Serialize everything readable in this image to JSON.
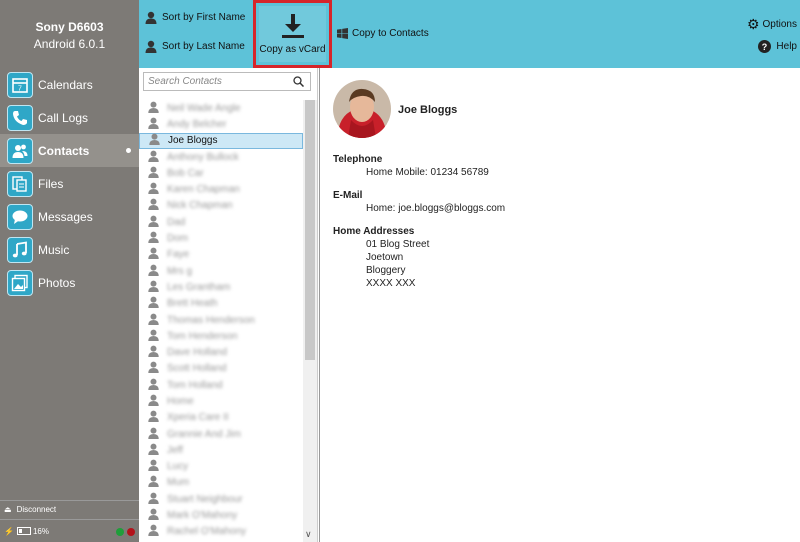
{
  "device": {
    "name": "Sony D6603",
    "os": "Android 6.0.1"
  },
  "sidebar": {
    "items": [
      {
        "label": "Calendars",
        "icon": "calendar-icon"
      },
      {
        "label": "Call Logs",
        "icon": "phone-icon"
      },
      {
        "label": "Contacts",
        "icon": "contacts-icon",
        "active": true
      },
      {
        "label": "Files",
        "icon": "files-icon"
      },
      {
        "label": "Messages",
        "icon": "message-icon"
      },
      {
        "label": "Music",
        "icon": "music-icon"
      },
      {
        "label": "Photos",
        "icon": "photos-icon"
      }
    ],
    "disconnect_label": "Disconnect",
    "battery_label": "16%"
  },
  "toolbar": {
    "sort_first": "Sort by First Name",
    "sort_last": "Sort by Last Name",
    "copy_vcard": "Copy as vCard",
    "copy_contacts": "Copy to Contacts",
    "options": "Options",
    "help": "Help"
  },
  "search": {
    "placeholder": "Search Contacts"
  },
  "contacts": [
    "Neil Wade Angle",
    "Andy Belcher",
    "Joe Bloggs",
    "Anthony Bullock",
    "Bob Car",
    "Karen Chapman",
    "Nick Chapman",
    "Dad",
    "Dom",
    "Faye",
    "Mrs g",
    "Les Grantham",
    "Brett Heath",
    "Thomas Henderson",
    "Tom Henderson",
    "Dave Holland",
    "Scott Holland",
    "Tom Holland",
    "Home",
    "Xperia Care II",
    "Grannie And Jim",
    "Jeff",
    "Lucy",
    "Mum",
    "Stuart Neighbour",
    "Mark O'Mahony",
    "Rachel O'Mahony"
  ],
  "selected_index": 2,
  "detail": {
    "name": "Joe Bloggs",
    "telephone_heading": "Telephone",
    "telephone_line": "Home Mobile:  01234 56789",
    "email_heading": "E-Mail",
    "email_line": "Home:  joe.bloggs@bloggs.com",
    "address_heading": "Home Addresses",
    "address_lines": [
      "01 Blog Street",
      "Joetown",
      "Bloggery",
      "XXXX XXX"
    ]
  },
  "colors": {
    "sidebar": "#7d7a76",
    "toolbar": "#5dc2d8",
    "icon_accent": "#2fa7c7",
    "highlight": "#d6252a"
  }
}
